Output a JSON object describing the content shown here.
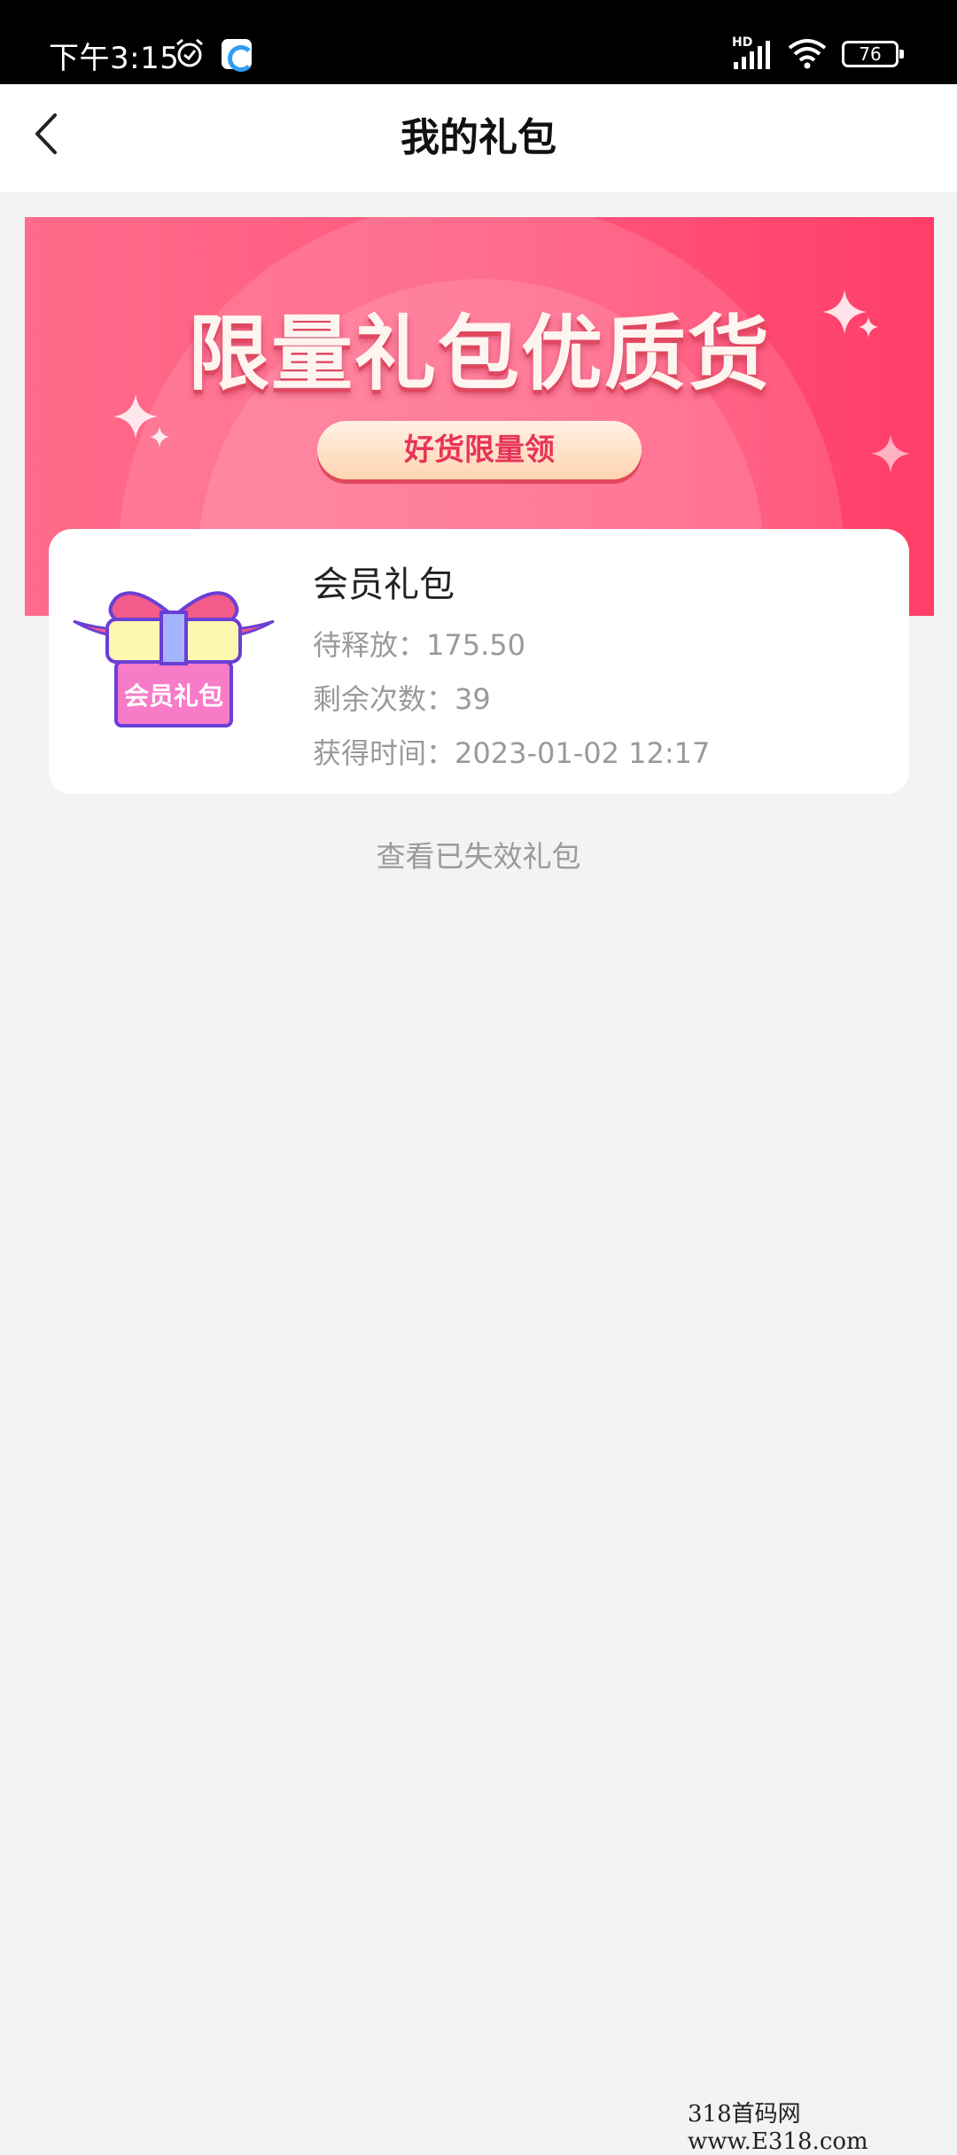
{
  "status_bar": {
    "time": "下午3:15",
    "network_label": "HD",
    "battery_level": "76",
    "icons": [
      "alarm-icon",
      "app-icon",
      "signal-icon",
      "wifi-icon",
      "battery-icon"
    ]
  },
  "header": {
    "title": "我的礼包",
    "back_icon": "chevron-left-icon"
  },
  "banner": {
    "headline": "限量礼包优质货",
    "button_label": "好货限量领",
    "colors": {
      "start": "#ff6b8a",
      "end": "#ff3e68"
    }
  },
  "gift": {
    "image_label": "会员礼包",
    "name": "会员礼包",
    "pending_label": "待释放：",
    "pending_value": "175.50",
    "remaining_label": "剩余次数：",
    "remaining_value": "39",
    "time_label": "获得时间：",
    "time_value": "2023-01-02 12:17"
  },
  "expired_link": "查看已失效礼包",
  "watermark": "318首码网 www.E318.com"
}
